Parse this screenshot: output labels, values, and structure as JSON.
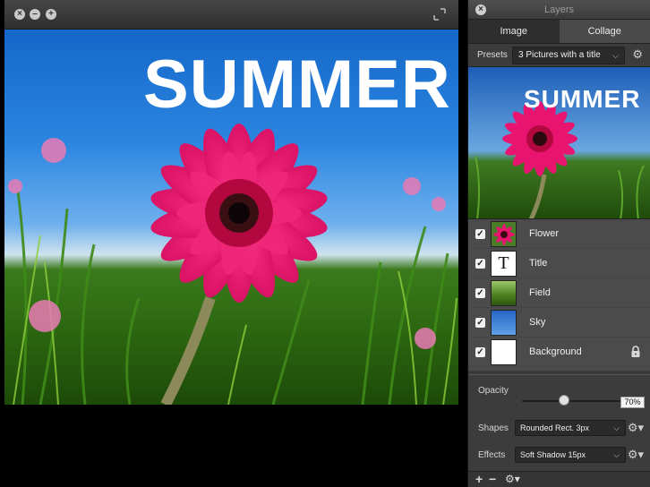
{
  "canvas": {
    "window_buttons": {
      "close": "×",
      "minimize": "–",
      "zoom": "+"
    },
    "title_text": "SUMMER"
  },
  "panel": {
    "title": "Layers",
    "tabs": [
      {
        "label": "Image"
      },
      {
        "label": "Collage"
      }
    ],
    "active_tab": "Collage",
    "presets": {
      "label": "Presets",
      "value": "3 Pictures with a title"
    },
    "layers": [
      {
        "name": "Flower",
        "checked": true,
        "thumb": "flower"
      },
      {
        "name": "Title",
        "checked": true,
        "thumb": "text",
        "thumb_text": "T"
      },
      {
        "name": "Field",
        "checked": true,
        "thumb": "field"
      },
      {
        "name": "Sky",
        "checked": true,
        "thumb": "sky"
      },
      {
        "name": "Background",
        "checked": true,
        "thumb": "blank",
        "locked": true
      }
    ],
    "opacity": {
      "label": "Opacity",
      "value": "70%"
    },
    "shapes": {
      "label": "Shapes",
      "value": "Rounded Rect. 3px"
    },
    "effects": {
      "label": "Effects",
      "value": "Soft Shadow 15px"
    },
    "footer": {
      "add": "+",
      "remove": "−"
    }
  },
  "colors": {
    "accent_flower": "#e8146f",
    "sky": "#1a6fd0",
    "panel_bg": "#3a3a3a"
  }
}
